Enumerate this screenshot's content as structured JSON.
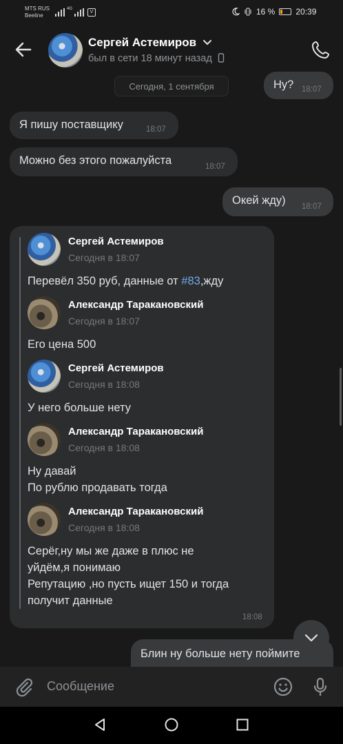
{
  "status_bar": {
    "carrier_line1": "MTS RUS",
    "carrier_line2": "Beeline",
    "battery": "16 %",
    "time": "20:39"
  },
  "header": {
    "contact_name": "Сергей Астемиров",
    "status": "был в сети 18 минут назад"
  },
  "date_separator": "Сегодня, 1 сентября",
  "messages": [
    {
      "text": "Ну?",
      "time": "18:07",
      "direction": "out"
    },
    {
      "text": "Я пишу поставщику",
      "time": "18:07",
      "direction": "in"
    },
    {
      "text": "Можно без этого пожалуйста",
      "time": "18:07",
      "direction": "in"
    },
    {
      "text": "Окей жду)",
      "time": "18:07",
      "direction": "out"
    }
  ],
  "forwarded": {
    "time": "18:08",
    "items": [
      {
        "author": "Сергей Астемиров",
        "date": "Сегодня в 18:07",
        "text_before": "Перевёл 350 руб, данные от ",
        "hashtag": "#83",
        "text_after": ",жду"
      },
      {
        "author": "Александр Таракановский",
        "date": "Сегодня в 18:07",
        "lines": [
          "Его цена 500"
        ]
      },
      {
        "author": "Сергей Астемиров",
        "date": "Сегодня в 18:08",
        "lines": [
          "У него больше нету"
        ]
      },
      {
        "author": "Александр Таракановский",
        "date": "Сегодня в 18:08",
        "lines": [
          "Ну давай",
          "По рублю продавать тогда"
        ]
      },
      {
        "author": "Александр Таракановский",
        "date": "Сегодня в 18:08",
        "lines": [
          "Серёг,ну мы же даже в плюс не",
          "уйдём,я понимаю",
          "Репутацию ,но пусть ищет 150 и тогда",
          "получит данные"
        ]
      }
    ]
  },
  "partial_message": "Блин ну больше нету поймите",
  "composer": {
    "placeholder": "Сообщение"
  },
  "icons": [
    "back-arrow-icon",
    "phone-icon",
    "mobile-device-icon",
    "chevron-down-icon",
    "paperclip-icon",
    "emoji-icon",
    "microphone-icon",
    "nav-back-icon",
    "nav-home-icon",
    "nav-recents-icon"
  ],
  "colors": {
    "background": "#191919",
    "bubble_in": "#2c2d2e",
    "bubble_out": "#393a3c",
    "hashtag": "#71aaeb"
  }
}
